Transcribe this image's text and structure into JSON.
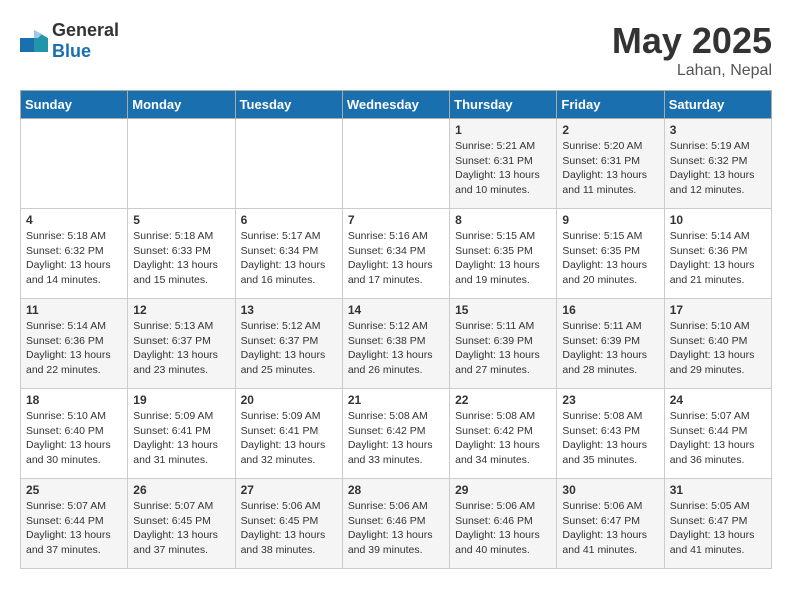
{
  "header": {
    "logo_general": "General",
    "logo_blue": "Blue",
    "month_year": "May 2025",
    "location": "Lahan, Nepal"
  },
  "weekdays": [
    "Sunday",
    "Monday",
    "Tuesday",
    "Wednesday",
    "Thursday",
    "Friday",
    "Saturday"
  ],
  "weeks": [
    [
      {
        "day": "",
        "info": ""
      },
      {
        "day": "",
        "info": ""
      },
      {
        "day": "",
        "info": ""
      },
      {
        "day": "",
        "info": ""
      },
      {
        "day": "1",
        "info": "Sunrise: 5:21 AM\nSunset: 6:31 PM\nDaylight: 13 hours\nand 10 minutes."
      },
      {
        "day": "2",
        "info": "Sunrise: 5:20 AM\nSunset: 6:31 PM\nDaylight: 13 hours\nand 11 minutes."
      },
      {
        "day": "3",
        "info": "Sunrise: 5:19 AM\nSunset: 6:32 PM\nDaylight: 13 hours\nand 12 minutes."
      }
    ],
    [
      {
        "day": "4",
        "info": "Sunrise: 5:18 AM\nSunset: 6:32 PM\nDaylight: 13 hours\nand 14 minutes."
      },
      {
        "day": "5",
        "info": "Sunrise: 5:18 AM\nSunset: 6:33 PM\nDaylight: 13 hours\nand 15 minutes."
      },
      {
        "day": "6",
        "info": "Sunrise: 5:17 AM\nSunset: 6:34 PM\nDaylight: 13 hours\nand 16 minutes."
      },
      {
        "day": "7",
        "info": "Sunrise: 5:16 AM\nSunset: 6:34 PM\nDaylight: 13 hours\nand 17 minutes."
      },
      {
        "day": "8",
        "info": "Sunrise: 5:15 AM\nSunset: 6:35 PM\nDaylight: 13 hours\nand 19 minutes."
      },
      {
        "day": "9",
        "info": "Sunrise: 5:15 AM\nSunset: 6:35 PM\nDaylight: 13 hours\nand 20 minutes."
      },
      {
        "day": "10",
        "info": "Sunrise: 5:14 AM\nSunset: 6:36 PM\nDaylight: 13 hours\nand 21 minutes."
      }
    ],
    [
      {
        "day": "11",
        "info": "Sunrise: 5:14 AM\nSunset: 6:36 PM\nDaylight: 13 hours\nand 22 minutes."
      },
      {
        "day": "12",
        "info": "Sunrise: 5:13 AM\nSunset: 6:37 PM\nDaylight: 13 hours\nand 23 minutes."
      },
      {
        "day": "13",
        "info": "Sunrise: 5:12 AM\nSunset: 6:37 PM\nDaylight: 13 hours\nand 25 minutes."
      },
      {
        "day": "14",
        "info": "Sunrise: 5:12 AM\nSunset: 6:38 PM\nDaylight: 13 hours\nand 26 minutes."
      },
      {
        "day": "15",
        "info": "Sunrise: 5:11 AM\nSunset: 6:39 PM\nDaylight: 13 hours\nand 27 minutes."
      },
      {
        "day": "16",
        "info": "Sunrise: 5:11 AM\nSunset: 6:39 PM\nDaylight: 13 hours\nand 28 minutes."
      },
      {
        "day": "17",
        "info": "Sunrise: 5:10 AM\nSunset: 6:40 PM\nDaylight: 13 hours\nand 29 minutes."
      }
    ],
    [
      {
        "day": "18",
        "info": "Sunrise: 5:10 AM\nSunset: 6:40 PM\nDaylight: 13 hours\nand 30 minutes."
      },
      {
        "day": "19",
        "info": "Sunrise: 5:09 AM\nSunset: 6:41 PM\nDaylight: 13 hours\nand 31 minutes."
      },
      {
        "day": "20",
        "info": "Sunrise: 5:09 AM\nSunset: 6:41 PM\nDaylight: 13 hours\nand 32 minutes."
      },
      {
        "day": "21",
        "info": "Sunrise: 5:08 AM\nSunset: 6:42 PM\nDaylight: 13 hours\nand 33 minutes."
      },
      {
        "day": "22",
        "info": "Sunrise: 5:08 AM\nSunset: 6:42 PM\nDaylight: 13 hours\nand 34 minutes."
      },
      {
        "day": "23",
        "info": "Sunrise: 5:08 AM\nSunset: 6:43 PM\nDaylight: 13 hours\nand 35 minutes."
      },
      {
        "day": "24",
        "info": "Sunrise: 5:07 AM\nSunset: 6:44 PM\nDaylight: 13 hours\nand 36 minutes."
      }
    ],
    [
      {
        "day": "25",
        "info": "Sunrise: 5:07 AM\nSunset: 6:44 PM\nDaylight: 13 hours\nand 37 minutes."
      },
      {
        "day": "26",
        "info": "Sunrise: 5:07 AM\nSunset: 6:45 PM\nDaylight: 13 hours\nand 37 minutes."
      },
      {
        "day": "27",
        "info": "Sunrise: 5:06 AM\nSunset: 6:45 PM\nDaylight: 13 hours\nand 38 minutes."
      },
      {
        "day": "28",
        "info": "Sunrise: 5:06 AM\nSunset: 6:46 PM\nDaylight: 13 hours\nand 39 minutes."
      },
      {
        "day": "29",
        "info": "Sunrise: 5:06 AM\nSunset: 6:46 PM\nDaylight: 13 hours\nand 40 minutes."
      },
      {
        "day": "30",
        "info": "Sunrise: 5:06 AM\nSunset: 6:47 PM\nDaylight: 13 hours\nand 41 minutes."
      },
      {
        "day": "31",
        "info": "Sunrise: 5:05 AM\nSunset: 6:47 PM\nDaylight: 13 hours\nand 41 minutes."
      }
    ]
  ]
}
